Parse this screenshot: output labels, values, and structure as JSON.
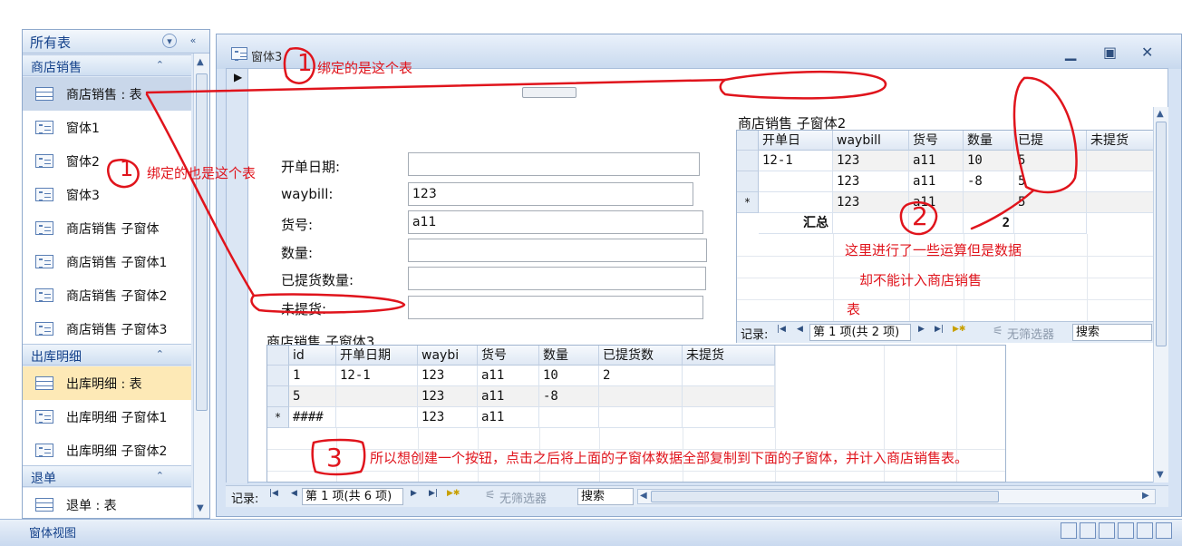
{
  "nav": {
    "title": "所有表",
    "groups": [
      {
        "title": "商店销售",
        "items": [
          "商店销售 : 表",
          "窗体1",
          "窗体2",
          "窗体3",
          "商店销售 子窗体",
          "商店销售 子窗体1",
          "商店销售 子窗体2",
          "商店销售 子窗体3"
        ]
      },
      {
        "title": "出库明细",
        "items": [
          "出库明细 : 表",
          "出库明细 子窗体1",
          "出库明细 子窗体2"
        ]
      },
      {
        "title": "退单",
        "items": [
          "退单 : 表"
        ]
      }
    ]
  },
  "status": {
    "text": "窗体视图"
  },
  "window": {
    "title": "窗体3"
  },
  "form": {
    "labels": [
      "开单日期:",
      "waybill:",
      "货号:",
      "数量:",
      "已提货数量:",
      "未提货:"
    ],
    "values": [
      "",
      "123",
      "a11",
      "",
      "",
      ""
    ]
  },
  "subform_right": {
    "title": "商店销售 子窗体2",
    "headers": [
      "开单日",
      "waybill",
      "货号",
      "数量",
      "已提",
      "未提货"
    ],
    "rows": [
      {
        "sel": "",
        "cells": [
          "12-1",
          "123",
          "a11",
          "10",
          "5",
          ""
        ]
      },
      {
        "sel": "",
        "cells": [
          "",
          "123",
          "a11",
          "-8",
          "5",
          ""
        ]
      },
      {
        "sel": "*",
        "cells": [
          "",
          "123",
          "a11",
          "",
          "5",
          ""
        ]
      }
    ],
    "total_label": "汇总",
    "total_value": "2",
    "recbar": {
      "label": "记录:",
      "position": "第 1 项(共 2 项)",
      "filter": "无筛选器",
      "search": "搜索"
    }
  },
  "subform_bottom": {
    "title": "商店销售 子窗体3",
    "headers": [
      "id",
      "开单日期",
      "waybi",
      "货号",
      "数量",
      "已提货数",
      "未提货"
    ],
    "rows": [
      {
        "sel": "",
        "cells": [
          "1",
          "12-1",
          "123",
          "a11",
          "10",
          "2",
          ""
        ]
      },
      {
        "sel": "",
        "cells": [
          "5",
          "",
          "123",
          "a11",
          "-8",
          "",
          ""
        ]
      },
      {
        "sel": "*",
        "cells": [
          "####",
          "",
          "123",
          "a11",
          "",
          "",
          ""
        ]
      }
    ]
  },
  "main_recbar": {
    "label": "记录:",
    "position": "第 1 项(共 6 项)",
    "filter": "无筛选器",
    "search": "搜索"
  },
  "annotations": {
    "n1a": "1",
    "a1": "绑定的是这个表",
    "n1b": "1",
    "a1b": "绑定的也是这个表",
    "n2": "2",
    "a2_line1": "这里进行了一些运算但是数据",
    "a2_line2": "却不能计入商店销售",
    "a2_line3": "表",
    "n3": "3",
    "a3": "所以想创建一个按钮，点击之后将上面的子窗体数据全部复制到下面的子窗体，并计入商店销售表。"
  }
}
